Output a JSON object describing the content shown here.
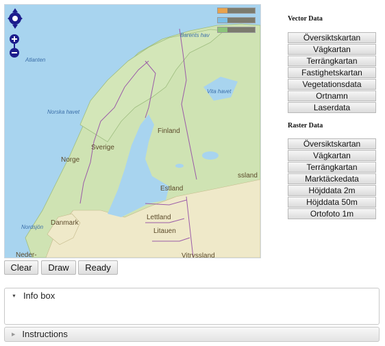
{
  "map": {
    "legend_colors": [
      "#e8a24c",
      "#7cbfe8",
      "#8cc47a"
    ],
    "labels": {
      "barents": "Barents hav",
      "atlanten": "Atlanten",
      "norska": "Norska havet",
      "vita": "Vita havet",
      "nordsjon": "Nordsjön",
      "sverige": "Sverige",
      "norge": "Norge",
      "finland": "Finland",
      "estland": "Estland",
      "lettland": "Lettland",
      "litauen": "Litauen",
      "danmark": "Danmark",
      "vitryssland": "Vitryssland",
      "ryssland_frag": "ssland",
      "neder_frag": "Neder-"
    }
  },
  "vector": {
    "title": "Vector Data",
    "items": [
      "Översiktskartan",
      "Vägkartan",
      "Terrängkartan",
      "Fastighetskartan",
      "Vegetationsdata",
      "Ortnamn",
      "Laserdata"
    ]
  },
  "raster": {
    "title": "Raster Data",
    "items": [
      "Översiktskartan",
      "Vägkartan",
      "Terrängkartan",
      "Marktäckedata",
      "Höjddata 2m",
      "Höjddata 50m",
      "Ortofoto 1m"
    ]
  },
  "tools": {
    "clear": "Clear",
    "draw": "Draw",
    "ready": "Ready"
  },
  "info": {
    "title": "Info box"
  },
  "instructions": {
    "title": "Instructions"
  }
}
